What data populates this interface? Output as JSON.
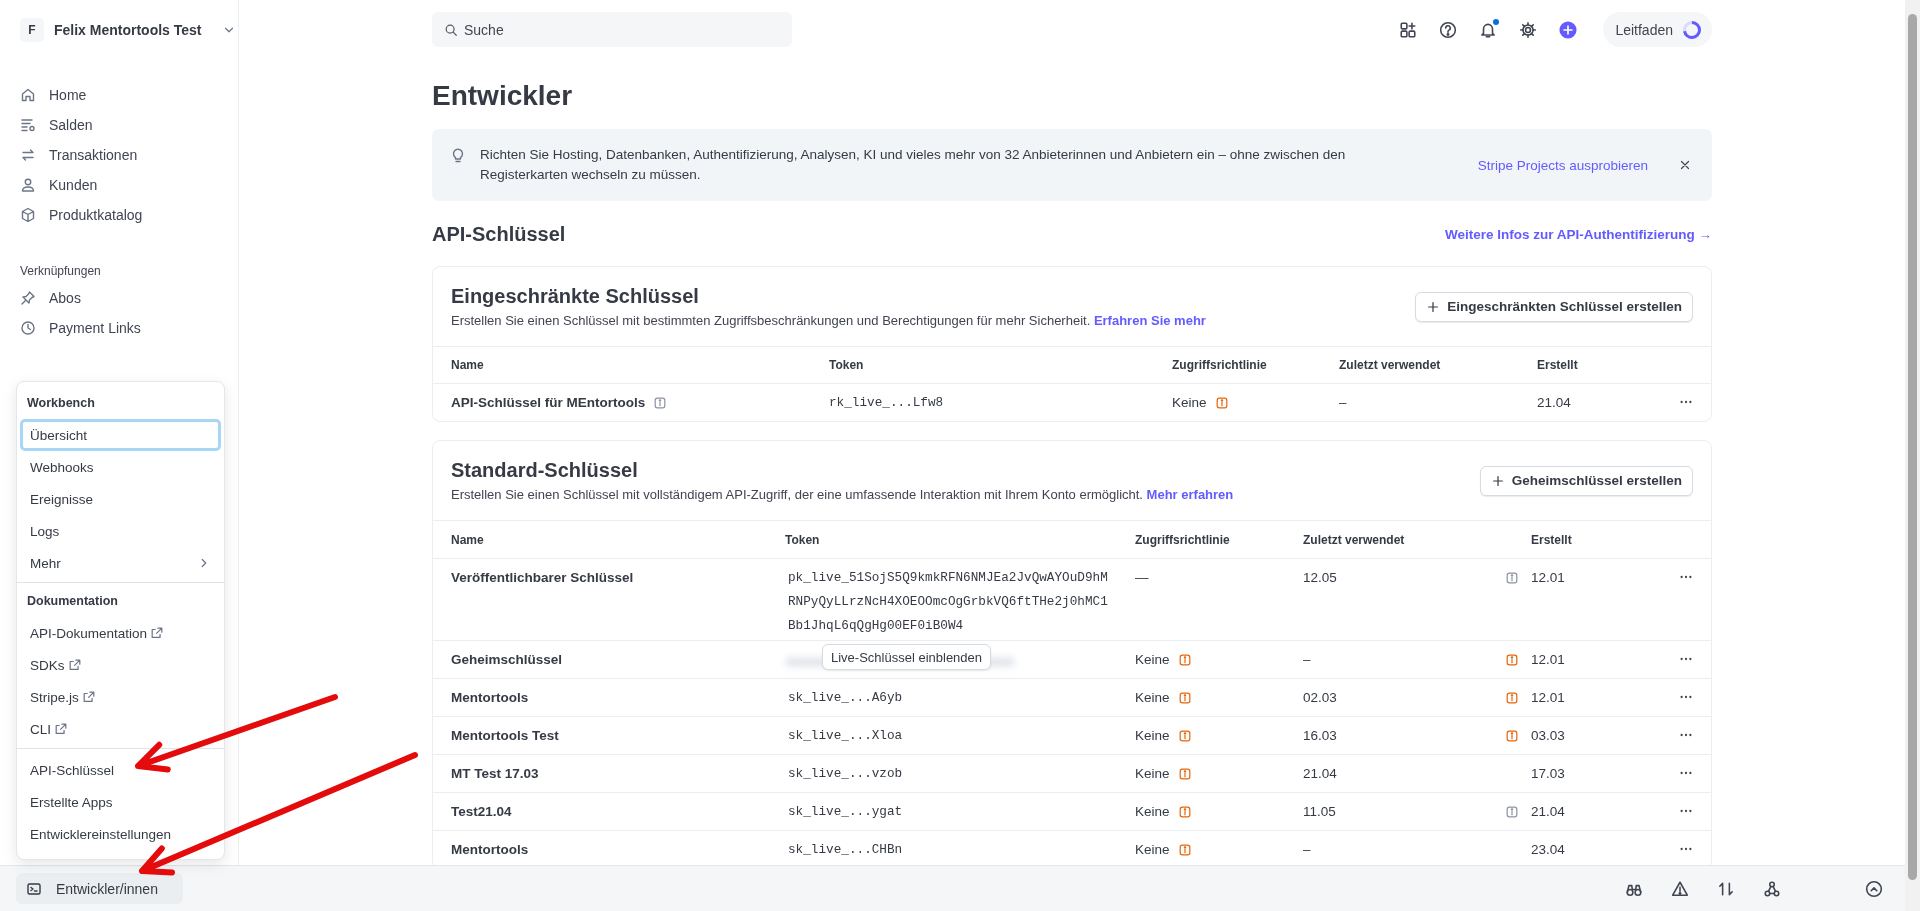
{
  "account": {
    "initial": "F",
    "name": "Felix Mentortools Test"
  },
  "nav": [
    {
      "label": "Home"
    },
    {
      "label": "Salden"
    },
    {
      "label": "Transaktionen"
    },
    {
      "label": "Kunden"
    },
    {
      "label": "Produktkatalog"
    }
  ],
  "shortcuts": {
    "heading": "Verknüpfungen",
    "items": [
      {
        "label": "Abos"
      },
      {
        "label": "Payment Links"
      }
    ]
  },
  "developer_menu": [
    {
      "heading": "Workbench",
      "items": [
        {
          "label": "Übersicht",
          "kind": "item",
          "selected": true
        },
        {
          "label": "Webhooks",
          "kind": "item",
          "selected": false
        },
        {
          "label": "Ereignisse",
          "kind": "item",
          "selected": false
        },
        {
          "label": "Logs",
          "kind": "item",
          "selected": false
        },
        {
          "label": "Mehr",
          "kind": "submenu",
          "selected": false
        }
      ]
    },
    {
      "heading": "Dokumentation",
      "items": [
        {
          "label": "API-Dokumentation",
          "kind": "external",
          "selected": false
        },
        {
          "label": "SDKs",
          "kind": "external",
          "selected": false
        },
        {
          "label": "Stripe.js",
          "kind": "external",
          "selected": false
        },
        {
          "label": "CLI",
          "kind": "external",
          "selected": false
        }
      ]
    },
    {
      "items": [
        {
          "label": "API-Schlüssel",
          "kind": "item",
          "selected": false
        },
        {
          "label": "Erstellte Apps",
          "kind": "item",
          "selected": false
        },
        {
          "label": "Entwicklereinstellungen",
          "kind": "item",
          "selected": false
        }
      ]
    }
  ],
  "developer_button": {
    "label": "Entwickler/innen"
  },
  "search": {
    "placeholder": "Suche"
  },
  "guide": {
    "label": "Leitfaden",
    "level": 0.72
  },
  "notifications": {
    "unread": true
  },
  "page_title": "Entwickler",
  "banner": {
    "text": "Richten Sie Hosting, Datenbanken, Authentifizierung, Analysen, KI und vieles mehr von 32 Anbieterinnen und Anbietern ein – ohne zwischen den Registerkarten wechseln zu müssen.",
    "link": "Stripe Projects ausprobieren"
  },
  "section": {
    "title": "API-Schlüssel",
    "link": "Weitere Infos zur API-Authentifizierung →"
  },
  "tables": [
    {
      "title": "Eingeschränkte Schlüssel",
      "description": "Erstellen Sie einen Schlüssel mit bestimmten Zugriffsbeschränkungen und Berechtigungen für mehr Sicherheit.",
      "link": "Erfahren Sie mehr",
      "button": "Eingeschränkten Schlüssel erstellen",
      "columns": [
        "Name",
        "Token",
        "Zugriffsrichtlinie",
        "Zuletzt verwendet",
        "Erstellt"
      ],
      "rows": [
        {
          "name": "API-Schlüssel für MEntortools",
          "name_info": true,
          "token": "rk_live_...Lfw8",
          "policy": "Keine",
          "policy_warning": true,
          "last_used": "–",
          "created": "21.04"
        }
      ]
    },
    {
      "title": "Standard-Schlüssel",
      "description": "Erstellen Sie einen Schlüssel mit vollständigem API-Zugriff, der eine umfassende Interaktion mit Ihrem Konto ermöglicht.",
      "link": "Mehr erfahren",
      "button": "Geheimschlüssel erstellen",
      "columns": [
        "Name",
        "Token",
        "Zugriffsrichtlinie",
        "Zuletzt verwendet",
        "Erstellt"
      ],
      "rows": [
        {
          "name": "Veröffentlichbarer Schlüssel",
          "token": "pk_live_51SojS5Q9kmkRFN6NMJEa2JvQwAYOuD9hMRNPyQyLLrzNcH4XOEOOmcOgGrbkVQ6ftTHe2j0hMC1Bb1JhqL6qQgHg00EF0iB0W4",
          "policy": "—",
          "policy_warning": false,
          "last_used": "12.05",
          "note": {
            "kind": "info"
          },
          "created": "12.01"
        },
        {
          "name": "Geheimschlüssel",
          "token_hidden": true,
          "reveal_button": "Live-Schlüssel einblenden",
          "policy": "Keine",
          "policy_warning": true,
          "last_used": "–",
          "note": {
            "kind": "warning"
          },
          "created": "12.01"
        },
        {
          "name": "Mentortools",
          "token": "sk_live_...A6yb",
          "policy": "Keine",
          "policy_warning": true,
          "last_used": "02.03",
          "note": {
            "kind": "warning"
          },
          "created": "12.01"
        },
        {
          "name": "Mentortools Test",
          "token": "sk_live_...Xloa",
          "policy": "Keine",
          "policy_warning": true,
          "last_used": "16.03",
          "note": {
            "kind": "warning"
          },
          "created": "03.03"
        },
        {
          "name": "MT Test 17.03",
          "token": "sk_live_...vzob",
          "policy": "Keine",
          "policy_warning": true,
          "last_used": "21.04",
          "created": "17.03"
        },
        {
          "name": "Test21.04",
          "token": "sk_live_...ygat",
          "policy": "Keine",
          "policy_warning": true,
          "last_used": "11.05",
          "note": {
            "kind": "info"
          },
          "created": "21.04"
        },
        {
          "name": "Mentortools",
          "token": "sk_live_...CHBn",
          "policy": "Keine",
          "policy_warning": true,
          "last_used": "–",
          "created": "23.04"
        }
      ]
    }
  ],
  "annotations": [
    {
      "kind": "arrow"
    },
    {
      "kind": "arrow"
    }
  ]
}
